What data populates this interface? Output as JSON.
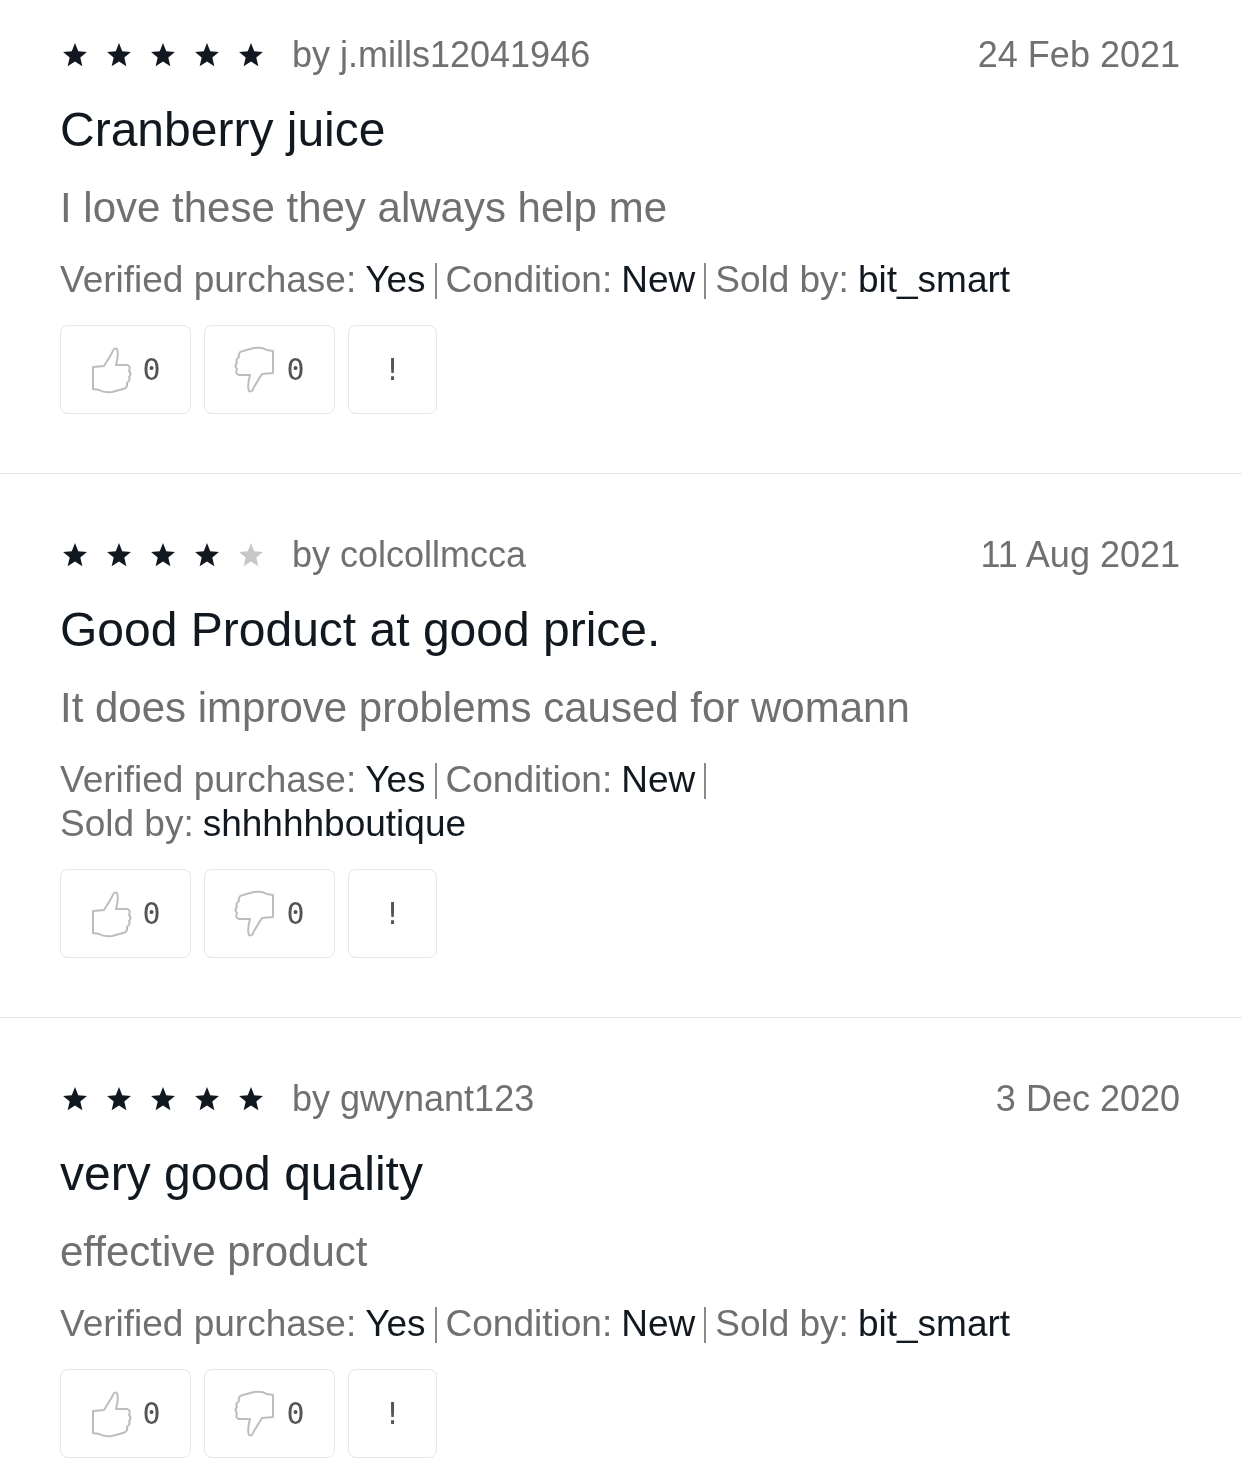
{
  "reviews": [
    {
      "stars": 5,
      "author": "by j.mills12041946",
      "date": "24 Feb 2021",
      "title": "Cranberry juice",
      "body": "I love these they always help me",
      "details": [
        {
          "label": "Verified purchase:",
          "value": "Yes"
        },
        {
          "label": "Condition:",
          "value": "New"
        },
        {
          "label": "Sold by:",
          "value": "bit_smart"
        }
      ],
      "helpful_count": "0",
      "unhelpful_count": "0",
      "report": "!"
    },
    {
      "stars": 4,
      "author": "by colcollmcca",
      "date": "11 Aug 2021",
      "title": "Good Product at good price.",
      "body": "It does improve problems caused for womann",
      "details": [
        {
          "label": "Verified purchase:",
          "value": "Yes"
        },
        {
          "label": "Condition:",
          "value": "New"
        },
        {
          "label": "Sold by:",
          "value": "shhhhhboutique"
        }
      ],
      "helpful_count": "0",
      "unhelpful_count": "0",
      "report": "!"
    },
    {
      "stars": 5,
      "author": "by gwynant123",
      "date": "3 Dec 2020",
      "title": "very good quality",
      "body": "effective product",
      "details": [
        {
          "label": "Verified purchase:",
          "value": "Yes"
        },
        {
          "label": "Condition:",
          "value": "New"
        },
        {
          "label": "Sold by:",
          "value": "bit_smart"
        }
      ],
      "helpful_count": "0",
      "unhelpful_count": "0",
      "report": "!"
    }
  ]
}
